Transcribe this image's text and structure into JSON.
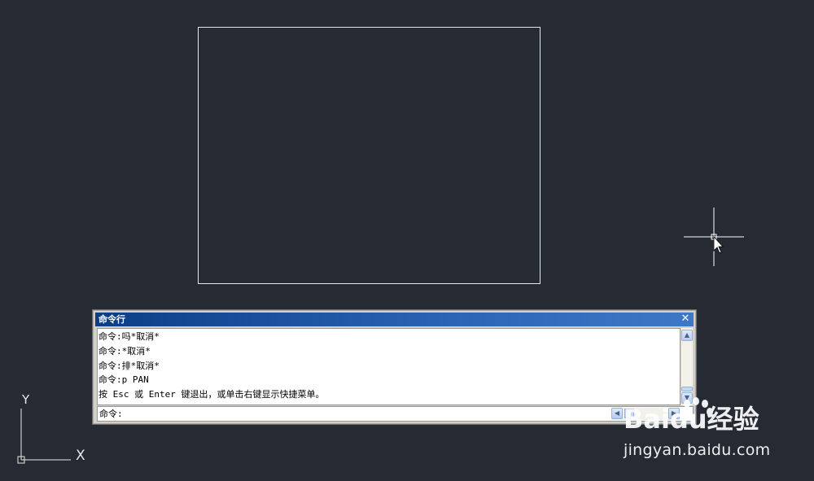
{
  "canvas": {
    "background_color": "#252a33",
    "line_color": "#e6e6e6"
  },
  "ucs": {
    "x_label": "X",
    "y_label": "Y"
  },
  "command_window": {
    "title": "命令行",
    "close_label": "✕",
    "history": [
      "命令:吗*取消*",
      "命令:*取消*",
      "命令:排*取消*",
      "命令:p PAN",
      "按 Esc 或 Enter 键退出，或单击右键显示快捷菜单。"
    ],
    "prompt": "命令:",
    "input_value": "",
    "title_bar_color": "#1f55a3"
  },
  "watermark": {
    "brand": "Baidu经验",
    "url": "jingyan.baidu.com"
  },
  "icons": {
    "scroll_up": "chevron-up-icon",
    "scroll_down": "chevron-down-icon",
    "scroll_left": "chevron-left-icon",
    "scroll_right": "chevron-right-icon",
    "cursor": "crosshair-cursor-icon",
    "close": "close-icon"
  }
}
